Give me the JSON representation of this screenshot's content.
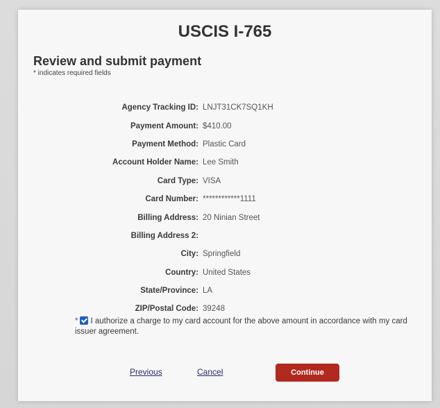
{
  "header": {
    "title": "USCIS I-765"
  },
  "section": {
    "title": "Review and submit payment",
    "required_note": "* indicates required fields"
  },
  "details": [
    {
      "label": "Agency Tracking ID:",
      "value": "LNJT31CK7SQ1KH"
    },
    {
      "label": "Payment Amount:",
      "value": "$410.00"
    },
    {
      "label": "Payment Method:",
      "value": "Plastic Card"
    },
    {
      "label": "Account Holder Name:",
      "value": "Lee Smith"
    },
    {
      "label": "Card Type:",
      "value": "VISA"
    },
    {
      "label": "Card Number:",
      "value": "************1111"
    },
    {
      "label": "Billing Address:",
      "value": "20 Ninian Street"
    },
    {
      "label": "Billing Address 2:",
      "value": ""
    },
    {
      "label": "City:",
      "value": "Springfield"
    },
    {
      "label": "Country:",
      "value": "United States"
    },
    {
      "label": "State/Province:",
      "value": "LA"
    },
    {
      "label": "ZIP/Postal Code:",
      "value": "39248"
    }
  ],
  "authorization": {
    "required_marker": "*",
    "checked": true,
    "text": "I authorize a charge to my card account for the above amount in accordance with my card issuer agreement."
  },
  "actions": {
    "previous_label": "Previous",
    "cancel_label": "Cancel",
    "continue_label": "Continue"
  },
  "colors": {
    "continue_button": "#b22a1f",
    "checkbox": "#1f5fbf"
  }
}
